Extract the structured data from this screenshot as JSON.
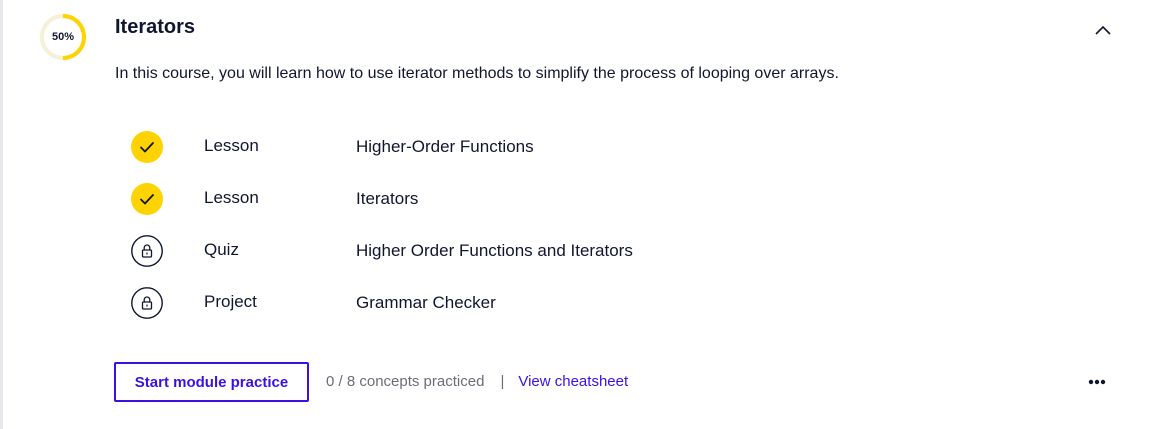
{
  "module": {
    "progress_label": "50%",
    "progress_fraction": 0.5,
    "title": "Iterators",
    "description": "In this course, you will learn how to use iterator methods to simplify the process of looping over arrays."
  },
  "items": [
    {
      "type": "Lesson",
      "name": "Higher-Order Functions",
      "status": "complete",
      "icon": "check-icon"
    },
    {
      "type": "Lesson",
      "name": "Iterators",
      "status": "complete",
      "icon": "check-icon"
    },
    {
      "type": "Quiz",
      "name": "Higher Order Functions and Iterators",
      "status": "locked",
      "icon": "lock-icon"
    },
    {
      "type": "Project",
      "name": "Grammar Checker",
      "status": "locked",
      "icon": "lock-icon"
    }
  ],
  "footer": {
    "practice_button_label": "Start module practice",
    "concepts_text": "0 / 8 concepts practiced",
    "divider": "|",
    "cheatsheet_label": "View cheatsheet"
  },
  "colors": {
    "accent": "#3a10e5",
    "progress": "#ffd300",
    "complete": "#ffd300",
    "text": "#10162f",
    "muted": "#6b6d7a"
  }
}
